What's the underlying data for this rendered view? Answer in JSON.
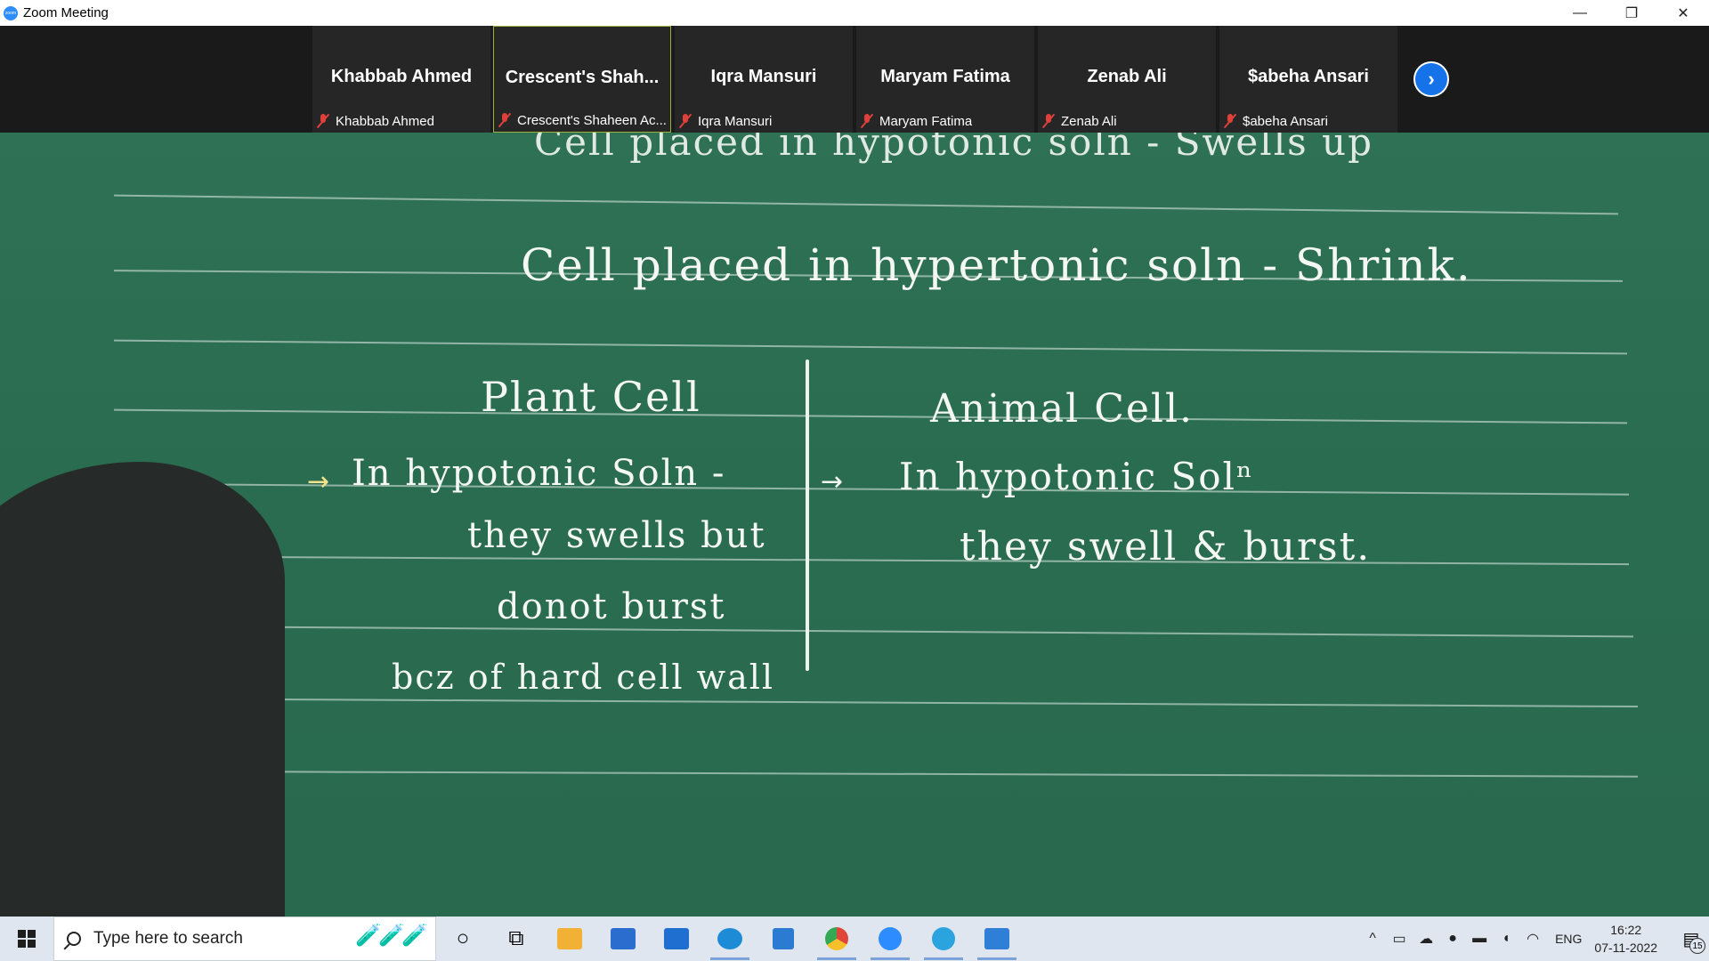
{
  "window": {
    "title": "Zoom Meeting",
    "logo_text": "zoom",
    "controls": {
      "minimize": "—",
      "restore": "❐",
      "close": "✕"
    }
  },
  "participants": [
    {
      "name": "Khabbab Ahmed",
      "label": "Khabbab Ahmed",
      "active": false
    },
    {
      "name": "Crescent's  Shah...",
      "label": "Crescent's Shaheen Ac...",
      "active": true
    },
    {
      "name": "Iqra Mansuri",
      "label": "Iqra Mansuri",
      "active": false
    },
    {
      "name": "Maryam Fatima",
      "label": "Maryam Fatima",
      "active": false
    },
    {
      "name": "Zenab Ali",
      "label": "Zenab Ali",
      "active": false
    },
    {
      "name": "$abeha Ansari",
      "label": "$abeha Ansari",
      "active": false
    }
  ],
  "next_page": "›",
  "board": {
    "line0": "Cell placed in hypotonic soln - Swells up",
    "line1": "Cell placed in hypertonic soln - Shrink.",
    "left_heading": "Plant Cell",
    "left_1": "In hypotonic Soln -",
    "left_2": "they swells but",
    "left_3": "donot burst",
    "left_4": "bcz of hard cell wall",
    "right_heading": "Animal Cell.",
    "right_1": "In hypotonic Solⁿ",
    "right_2": "they swell & burst.",
    "arrow": "→"
  },
  "taskbar": {
    "search_placeholder": "Type here to search",
    "search_art": "🧪🧪🧪",
    "cortana": "○",
    "task_view": "⧉",
    "apps": [
      {
        "name": "file-explorer",
        "glyph": "📁",
        "color": "#f2b134",
        "running": false
      },
      {
        "name": "store",
        "glyph": "🛍",
        "color": "#2b6ccf",
        "running": false
      },
      {
        "name": "mail",
        "glyph": "✉",
        "color": "#1f6fd1",
        "running": false
      },
      {
        "name": "edge",
        "glyph": "e",
        "color": "#1e8bd6",
        "running": true
      },
      {
        "name": "vscode",
        "glyph": "⟩",
        "color": "#2a7bd1",
        "running": false
      },
      {
        "name": "chrome",
        "glyph": "◉",
        "color": "#e0453a",
        "running": true
      },
      {
        "name": "zoom",
        "glyph": "zoom",
        "color": "#2d8cff",
        "running": true
      },
      {
        "name": "telegram",
        "glyph": "➤",
        "color": "#2aa3df",
        "running": true
      },
      {
        "name": "photos",
        "glyph": "🏔",
        "color": "#2f7fd6",
        "running": true
      }
    ],
    "tray": {
      "chevron": "^",
      "language": "ENG",
      "time": "16:22",
      "date": "07-11-2022",
      "notifications": "15"
    }
  }
}
